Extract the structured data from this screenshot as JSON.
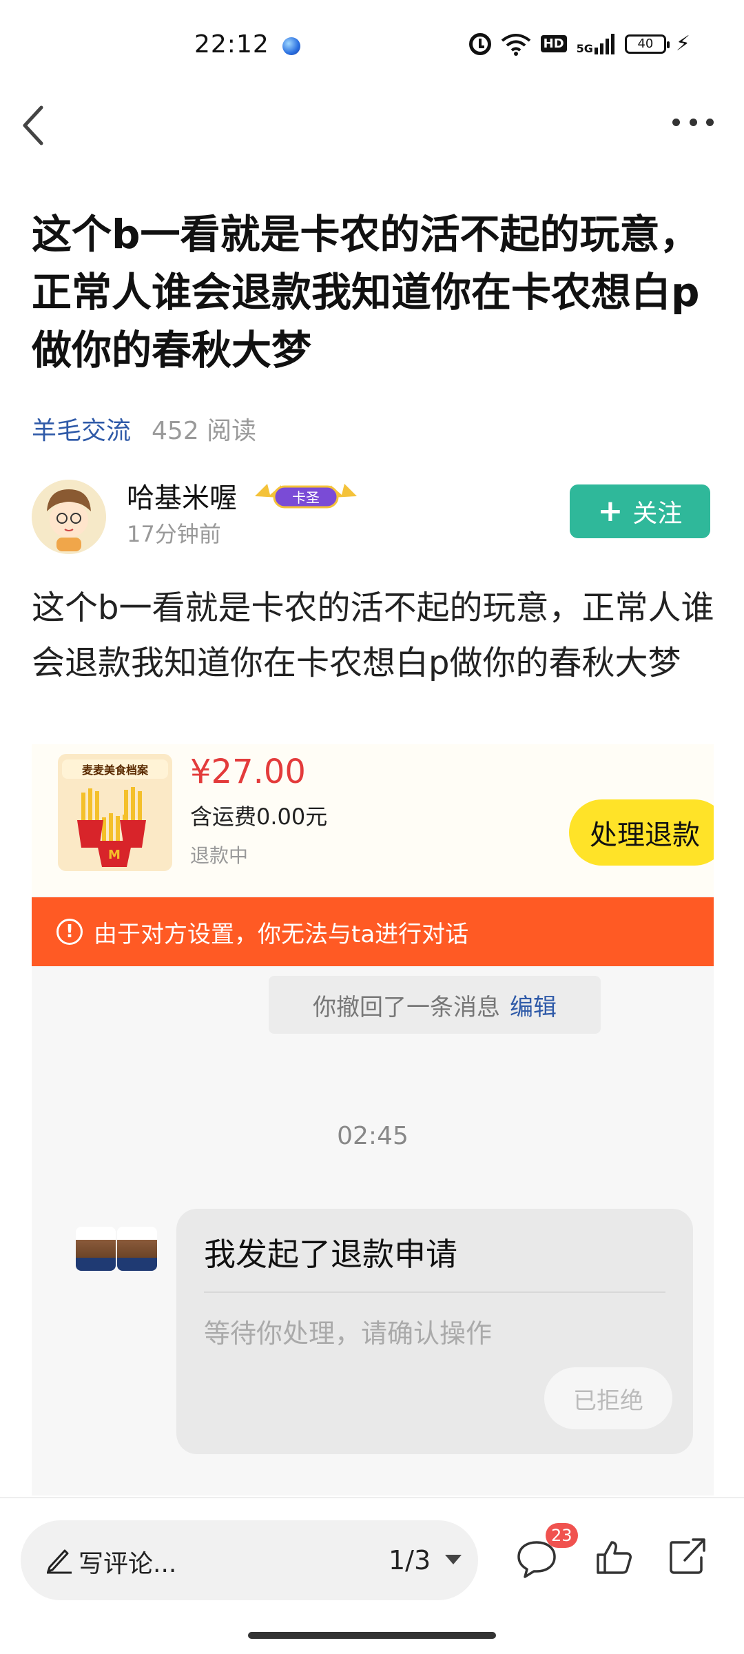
{
  "status_bar": {
    "time": "22:12",
    "hd_label": "HD",
    "network_label": "5G",
    "battery_level": "40",
    "icons": [
      "alarm-icon",
      "wifi-icon",
      "hd-icon",
      "signal-icon",
      "battery-icon",
      "charging-icon"
    ]
  },
  "nav": {
    "back_icon": "back-chevron-icon",
    "more_icon": "more-dots-icon"
  },
  "post": {
    "title": "这个b一看就是卡农的活不起的玩意，正常人谁会退款我知道你在卡农想白p做你的春秋大梦",
    "topic": "羊毛交流",
    "reads": "452 阅读",
    "author": {
      "name": "哈基米喔",
      "badge": "卡圣",
      "time": "17分钟前"
    },
    "follow_label": "关注",
    "body": "这个b一看就是卡农的活不起的玩意，正常人谁会退款我知道你在卡农想白p做你的春秋大梦"
  },
  "screenshot": {
    "product_caption": "麦麦美食档案",
    "price": "¥27.00",
    "shipping": "含运费0.00元",
    "order_status": "退款中",
    "refund_button": "处理退款",
    "notice": "由于对方设置，你无法与ta进行对话",
    "recall_text": "你撤回了一条消息",
    "recall_edit": "编辑",
    "chat_time": "02:45",
    "message_title": "我发起了退款申请",
    "message_sub": "等待你处理，请确认操作",
    "message_status": "已拒绝"
  },
  "bottom_bar": {
    "comment_placeholder": "写评论...",
    "page_indicator": "1/3",
    "comment_count": "23"
  },
  "colors": {
    "follow_button": "#2fb89a",
    "topic_link": "#2f5aa8",
    "price": "#e33b3b",
    "refund_button": "#ffe328",
    "notice_bar": "#ff5a24",
    "badge": "#f0524f"
  }
}
